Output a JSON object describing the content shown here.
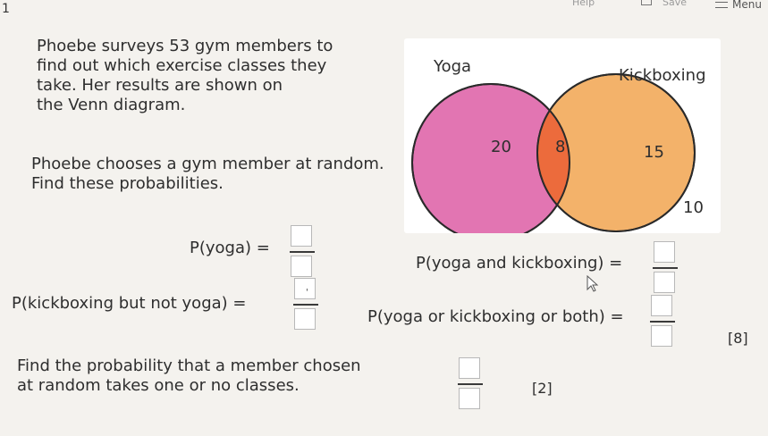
{
  "topbar": {
    "partial_left": "1",
    "partial_help": "Help",
    "partial_save": "Save",
    "menu_label": "Menu"
  },
  "question": {
    "intro": [
      "Phoebe surveys 53 gym members to",
      "find out which exercise classes they",
      "take. Her results are shown on",
      "the Venn diagram."
    ],
    "chooses": [
      "Phoebe chooses a gym member at random.",
      "Find these probabilities."
    ],
    "p_yoga": "P(yoga) =",
    "p_kick_not_yoga": "P(kickboxing but not yoga) =",
    "p_yoga_and_kick": "P(yoga and kickboxing) =",
    "p_yoga_or_kick": "P(yoga or kickboxing or both) =",
    "marks_part1": "[8]",
    "find_prob": [
      "Find the probability that a member chosen",
      "at random takes one or no classes."
    ],
    "marks_part2": "[2]"
  },
  "venn": {
    "label_a": "Yoga",
    "label_b": "Kickboxing",
    "only_a": "20",
    "both": "8",
    "only_b": "15",
    "neither": "10",
    "color_a": "#e275b2",
    "color_b": "#f3b26a",
    "color_overlap": "#ec6b3c"
  },
  "answers": {
    "p_kick_not_yoga_num": "'"
  }
}
